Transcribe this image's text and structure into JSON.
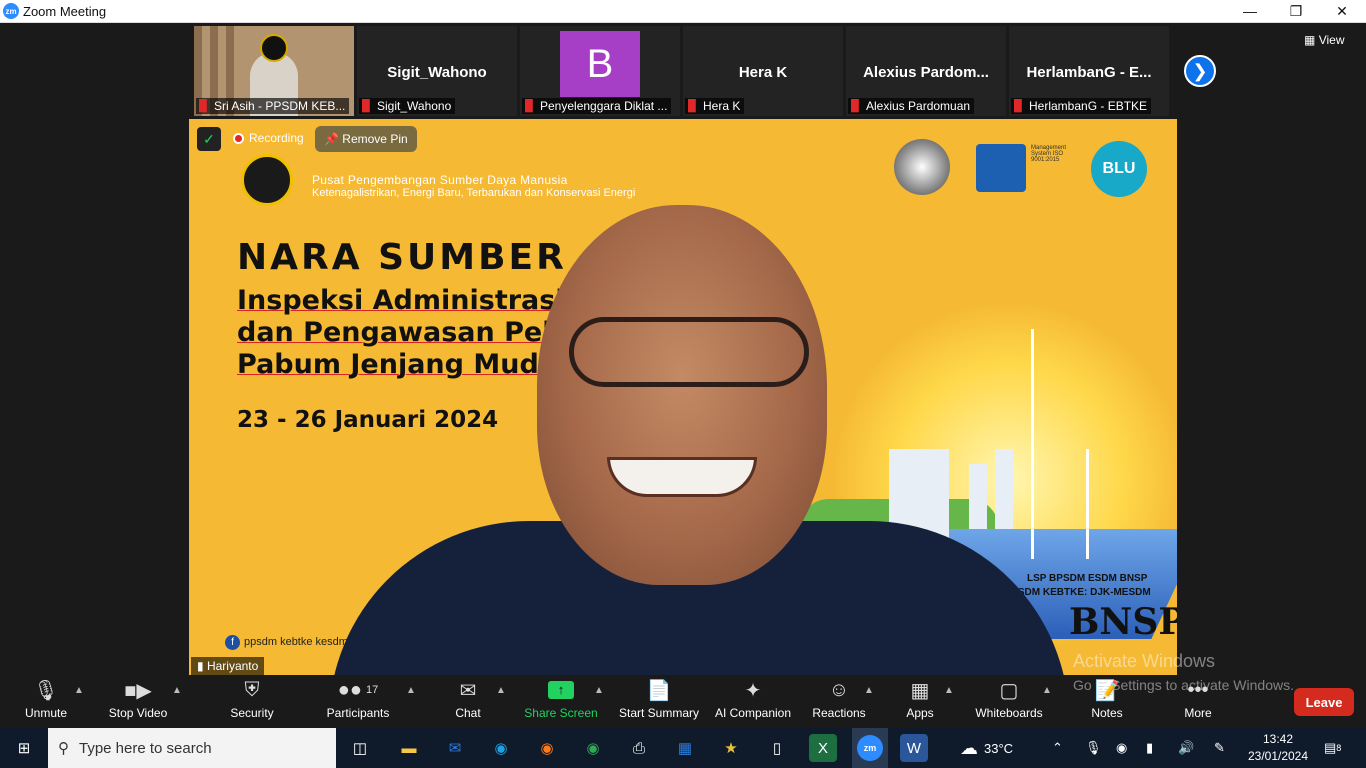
{
  "window": {
    "title": "Zoom Meeting",
    "app_icon": "zm"
  },
  "strip": {
    "tiles": [
      {
        "name": "",
        "label": "Sri Asih - PPSDM KEB..."
      },
      {
        "name": "Sigit_Wahono",
        "label": "Sigit_Wahono"
      },
      {
        "name": "B",
        "label": "Penyelenggara Diklat ..."
      },
      {
        "name": "Hera K",
        "label": "Hera K"
      },
      {
        "name": "Alexius  Pardom...",
        "label": "Alexius Pardomuan"
      },
      {
        "name": "HerlambanG  - E...",
        "label": "HerlambanG - EBTKE"
      }
    ],
    "view_label": "View"
  },
  "main": {
    "recording": "Recording",
    "remove_pin": "Remove Pin",
    "speaker_name": "Hariyanto",
    "slide": {
      "org1": "Pusat Pengembangan Sumber Daya Manusia",
      "org2": "Ketenagalistrikan, Energi Baru, Terbarukan dan Konservasi Energi",
      "heading": "NARA SUMBER",
      "line1": "Inspeksi Administrasi P",
      "line2": "dan Pengawasan Pelak",
      "line3": "Pabum Jenjang Muda",
      "date": "23 - 26 Januari 2024",
      "logo_blu": "BLU",
      "lsp1": "LSP BPSDM ESDM BNSP",
      "lsp2": "BPSDM KEBTKE: DJK-MESDM",
      "bnsp": "BNSP",
      "facebook": "ppsdm kebtke kesdm"
    }
  },
  "toolbar": {
    "unmute": "Unmute",
    "stop_video": "Stop Video",
    "security": "Security",
    "participants": "Participants",
    "participants_count": "17",
    "chat": "Chat",
    "share_screen": "Share Screen",
    "start_summary": "Start Summary",
    "ai_companion": "AI Companion",
    "reactions": "Reactions",
    "apps": "Apps",
    "whiteboards": "Whiteboards",
    "notes": "Notes",
    "more": "More",
    "leave": "Leave",
    "activate1": "Activate Windows",
    "activate2": "Go to Settings to activate Windows."
  },
  "taskbar": {
    "search_placeholder": "Type here to search",
    "weather": "33°C",
    "time": "13:42",
    "date": "23/01/2024",
    "notif_count": "8"
  },
  "colors": {
    "zoom_blue": "#0e72ed",
    "leave_red": "#d52b1e",
    "share_green": "#23d160",
    "slide_yellow": "#f5b933"
  }
}
